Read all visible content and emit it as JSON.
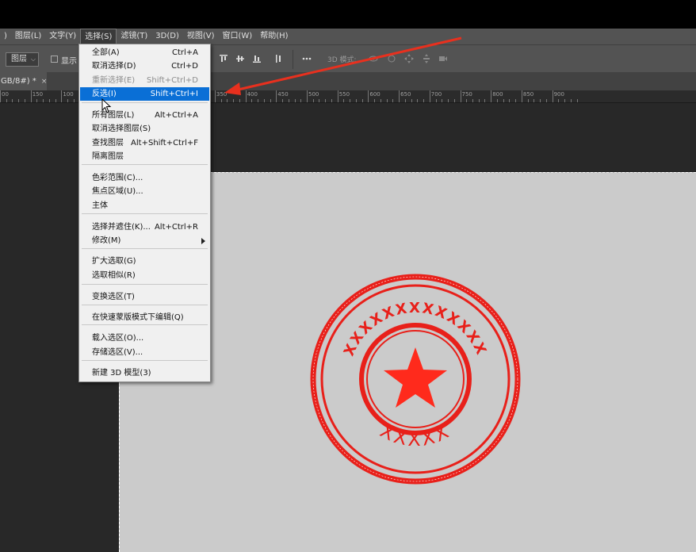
{
  "menubar": [
    {
      "label": ")"
    },
    {
      "label": "图层(L)"
    },
    {
      "label": "文字(Y)"
    },
    {
      "label": "选择(S)",
      "active": true
    },
    {
      "label": "滤镜(T)"
    },
    {
      "label": "3D(D)"
    },
    {
      "label": "视图(V)"
    },
    {
      "label": "窗口(W)"
    },
    {
      "label": "帮助(H)"
    }
  ],
  "options": {
    "select_value": "图层",
    "show_label": "显示",
    "mode_3d_label": "3D 模式:"
  },
  "tab": {
    "title": "GB/8#) *",
    "close": "×"
  },
  "ruler": {
    "labels": [
      "00",
      "150",
      "100",
      "150",
      "200",
      "250",
      "300",
      "350",
      "400",
      "450",
      "500",
      "550",
      "600",
      "650",
      "700",
      "750",
      "800",
      "850",
      "900"
    ]
  },
  "dropdown": {
    "items": [
      {
        "label": "全部(A)",
        "shortcut": "Ctrl+A"
      },
      {
        "label": "取消选择(D)",
        "shortcut": "Ctrl+D"
      },
      {
        "label": "重新选择(E)",
        "shortcut": "Shift+Ctrl+D",
        "disabled": true
      },
      {
        "label": "反选(I)",
        "shortcut": "Shift+Ctrl+I",
        "highlight": true
      },
      {
        "label": "所有图层(L)",
        "shortcut": "Alt+Ctrl+A"
      },
      {
        "label": "取消选择图层(S)",
        "shortcut": ""
      },
      {
        "label": "查找图层",
        "shortcut": "Alt+Shift+Ctrl+F"
      },
      {
        "label": "隔离图层",
        "shortcut": ""
      },
      {
        "label": "色彩范围(C)...",
        "shortcut": ""
      },
      {
        "label": "焦点区域(U)...",
        "shortcut": ""
      },
      {
        "label": "主体",
        "shortcut": ""
      },
      {
        "label": "选择并遮住(K)...",
        "shortcut": "Alt+Ctrl+R"
      },
      {
        "label": "修改(M)",
        "shortcut": "",
        "submenu": true
      },
      {
        "label": "扩大选取(G)",
        "shortcut": ""
      },
      {
        "label": "选取相似(R)",
        "shortcut": ""
      },
      {
        "label": "变换选区(T)",
        "shortcut": ""
      },
      {
        "label": "在快速蒙版模式下编辑(Q)",
        "shortcut": ""
      },
      {
        "label": "载入选区(O)...",
        "shortcut": ""
      },
      {
        "label": "存储选区(V)...",
        "shortcut": ""
      },
      {
        "label": "新建 3D 模型(3)",
        "shortcut": ""
      }
    ]
  },
  "stamp": {
    "top_text": "XXXXXXXXXXXXX",
    "bottom_text": "XXXXX",
    "stamp_color": "#e8201a"
  },
  "colors": {
    "highlight": "#0a6fd6",
    "annotation_arrow": "#e8301e"
  }
}
